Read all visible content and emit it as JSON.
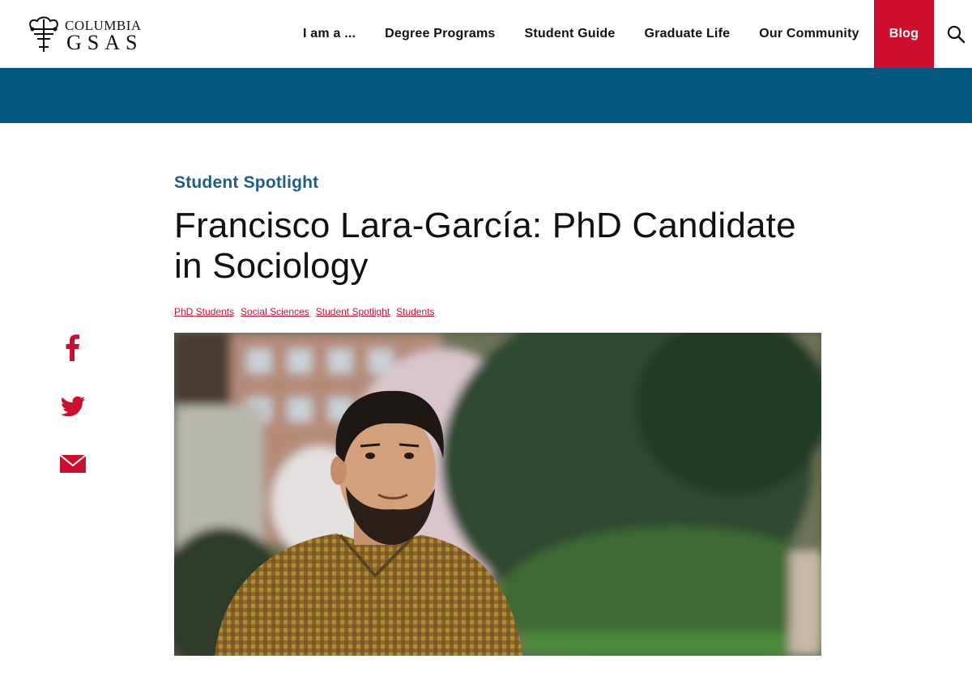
{
  "header": {
    "logo": {
      "line1": "COLUMBIA",
      "line2": "GSAS",
      "icon": "crown-icon"
    },
    "nav": [
      {
        "label": "I am a ..."
      },
      {
        "label": "Degree Programs"
      },
      {
        "label": "Student Guide"
      },
      {
        "label": "Graduate Life"
      },
      {
        "label": "Our Community"
      },
      {
        "label": "Blog",
        "active": true
      }
    ],
    "search_icon": "search-icon"
  },
  "colors": {
    "brand_red": "#cc0e2f",
    "band_blue": "#03587f",
    "category_blue": "#1c5f86"
  },
  "article": {
    "category": "Student Spotlight",
    "title": "Francisco Lara-García: PhD Candidate in Sociology",
    "tags": [
      "PhD Students",
      "Social Sciences",
      "Student Spotlight",
      "Students"
    ]
  },
  "social": [
    {
      "icon": "facebook-icon"
    },
    {
      "icon": "twitter-icon"
    },
    {
      "icon": "email-icon"
    }
  ]
}
